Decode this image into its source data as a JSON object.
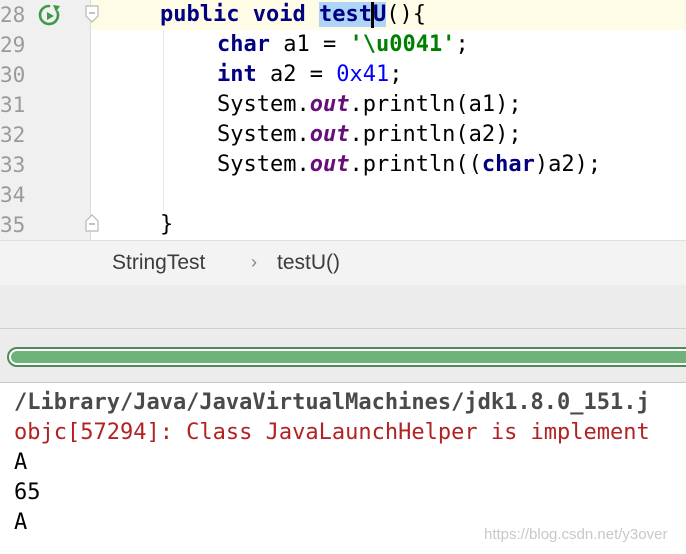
{
  "editor": {
    "line_numbers": [
      "28",
      "29",
      "30",
      "31",
      "32",
      "33",
      "34",
      "35"
    ],
    "lines": [
      {
        "t1": "public",
        "t2": " ",
        "t3": "void",
        "t4": " ",
        "sel": "testU",
        "t5": "(){"
      },
      {
        "t1": "char",
        "t2": " a1 = ",
        "t3": "'\\u0041'",
        "t4": ";"
      },
      {
        "t1": "int",
        "t2": " a2 = ",
        "t3": "0x41",
        "t4": ";"
      },
      {
        "t1": "System.",
        "t2": "out",
        "t3": ".println(a1);"
      },
      {
        "t1": "System.",
        "t2": "out",
        "t3": ".println(a2);"
      },
      {
        "t1": "System.",
        "t2": "out",
        "t3": ".println((",
        "t4": "char",
        "t5": ")a2);"
      },
      {
        "t1": ""
      },
      {
        "t1": "}"
      }
    ],
    "icons": {
      "run": "run-rerun-icon",
      "fold": "fold-marker-icon"
    }
  },
  "breadcrumb": {
    "items": [
      "StringTest",
      "testU()"
    ],
    "separator": "›"
  },
  "progress": {
    "fraction": 1.0,
    "color": "#6fb27a"
  },
  "console": {
    "lines": [
      "/Library/Java/JavaVirtualMachines/jdk1.8.0_151.j",
      "objc[57294]: Class JavaLaunchHelper is implement",
      "A",
      "65",
      "A"
    ]
  },
  "watermark": "https://blog.csdn.net/y3over"
}
